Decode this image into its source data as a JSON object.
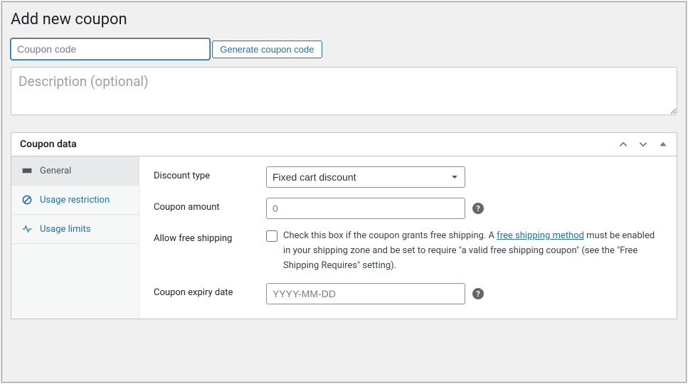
{
  "page": {
    "title": "Add new coupon"
  },
  "coupon_code": {
    "placeholder": "Coupon code",
    "value": ""
  },
  "generate_button": {
    "label": "Generate coupon code"
  },
  "description": {
    "placeholder": "Description (optional)",
    "value": ""
  },
  "panel": {
    "title": "Coupon data"
  },
  "tabs": {
    "general": {
      "label": "General"
    },
    "usage_restriction": {
      "label": "Usage restriction"
    },
    "usage_limits": {
      "label": "Usage limits"
    }
  },
  "fields": {
    "discount_type": {
      "label": "Discount type",
      "value": "Fixed cart discount"
    },
    "coupon_amount": {
      "label": "Coupon amount",
      "placeholder": "0",
      "value": ""
    },
    "allow_free_shipping": {
      "label": "Allow free shipping",
      "checked": false,
      "description_pre": "Check this box if the coupon grants free shipping. A ",
      "link_text": "free shipping method",
      "description_post": " must be enabled in your shipping zone and be set to require \"a valid free shipping coupon\" (see the \"Free Shipping Requires\" setting)."
    },
    "expiry_date": {
      "label": "Coupon expiry date",
      "placeholder": "YYYY-MM-DD",
      "value": ""
    }
  }
}
